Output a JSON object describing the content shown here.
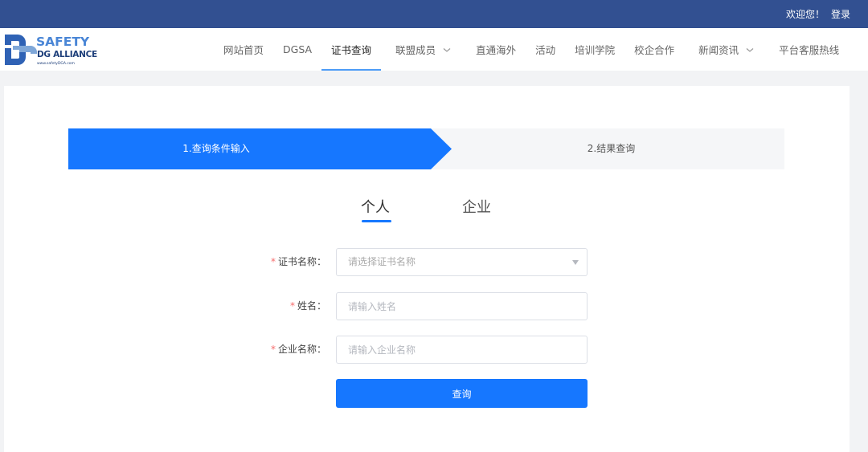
{
  "topbar": {
    "welcome": "欢迎您！",
    "login": "登录",
    "background_color": "#325091"
  },
  "logo": {
    "line1": "SAFETY",
    "line2": "DG ALLIANCE",
    "url": "www.safetyDGA.com"
  },
  "nav": {
    "items": [
      {
        "label": "网站首页"
      },
      {
        "label": "DGSA"
      },
      {
        "label": "证书查询",
        "active": true
      },
      {
        "label": "联盟成员",
        "dropdown": true
      },
      {
        "label": "直通海外"
      },
      {
        "label": "活动"
      },
      {
        "label": "培训学院"
      },
      {
        "label": "校企合作"
      },
      {
        "label": "新闻资讯",
        "dropdown": true
      },
      {
        "label": "平台客服热线"
      }
    ],
    "active_indicator_color": "#4e9cf7"
  },
  "steps": {
    "step1": "1.查询条件输入",
    "step2": "2.结果查询",
    "active_color": "#1677ff",
    "inactive_color": "#f5f6f8"
  },
  "tabs": {
    "personal": "个人",
    "company": "企业",
    "selected": "个人"
  },
  "form": {
    "required_mark": "*",
    "cert_name": {
      "label": "证书名称：",
      "placeholder": "请选择证书名称"
    },
    "person_name": {
      "label": "姓名：",
      "placeholder": "请输入姓名"
    },
    "company_name": {
      "label": "企业名称：",
      "placeholder": "请输入企业名称"
    },
    "submit_label": "查询",
    "primary_color": "#1677ff"
  }
}
